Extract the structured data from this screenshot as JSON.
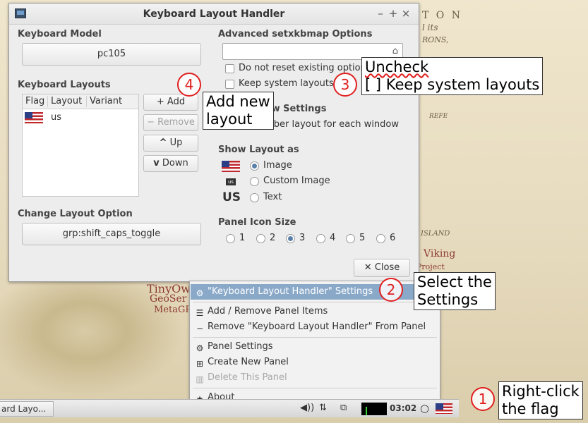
{
  "dialog": {
    "title": "Keyboard Layout Handler",
    "keyboard_model": {
      "title": "Keyboard Model",
      "value": "pc105"
    },
    "keyboard_layouts": {
      "title": "Keyboard Layouts",
      "columns": [
        "Flag",
        "Layout",
        "Variant"
      ],
      "rows": [
        {
          "flag": "us-flag-icon",
          "layout": "us",
          "variant": ""
        }
      ]
    },
    "buttons": {
      "add": "+ Add",
      "remove": "− Remove",
      "up": "Up",
      "down": "Down",
      "close": "Close"
    },
    "change_layout_option": {
      "title": "Change Layout Option",
      "value": "grp:shift_caps_toggle"
    },
    "advanced": {
      "title": "Advanced setxkbmap Options",
      "input_value": "",
      "do_not_reset": "Do not reset existing options",
      "keep_system_layouts": "Keep system layouts"
    },
    "per_window": {
      "title": "Per Window Settings",
      "remember": "Remember layout for each window"
    },
    "show_layout_as": {
      "title": "Show Layout as",
      "options": [
        "Image",
        "Custom Image",
        "Text"
      ],
      "selected": "Image",
      "text_preview": "US",
      "custom_badge": "us"
    },
    "panel_icon_size": {
      "title": "Panel Icon Size",
      "options": [
        "1",
        "2",
        "3",
        "4",
        "5",
        "6"
      ],
      "selected": "3"
    }
  },
  "context_menu": {
    "items": [
      {
        "label": "\"Keyboard Layout Handler\" Settings",
        "icon": "gear-icon",
        "highlighted": true
      },
      {
        "label": "Add / Remove Panel Items",
        "icon": "list-icon"
      },
      {
        "label": "Remove \"Keyboard Layout Handler\" From Panel",
        "icon": "minus-icon"
      },
      {
        "label": "Panel Settings",
        "icon": "gear-icon"
      },
      {
        "label": "Create New Panel",
        "icon": "plus-box-icon"
      },
      {
        "label": "Delete This Panel",
        "icon": "trash-icon",
        "disabled": true
      },
      {
        "label": "About",
        "icon": "star-icon"
      }
    ]
  },
  "panel": {
    "taskbar_item": "ard Layo...",
    "clock": "03:02"
  },
  "annotations": {
    "step1": {
      "number": "1",
      "text_line1": "Right-click",
      "text_line2": "the flag"
    },
    "step2": {
      "number": "2",
      "text_line1": "Select the",
      "text_line2": "Settings"
    },
    "step3": {
      "number": "3",
      "text_line1": "Uncheck",
      "text_line2": "[ ] Keep system layouts"
    },
    "step4": {
      "number": "4",
      "text_line1": "Add new",
      "text_line2": "layout"
    }
  },
  "background_map": {
    "labels": [
      "T O N",
      "l its",
      "RONS,",
      "REFE",
      "ISLAND",
      "Viking",
      "Project",
      "TinyOw",
      "GeoSer",
      "MetaGR"
    ]
  },
  "colors": {
    "highlight": "#8aa9c9",
    "annotation_red": "#e02020",
    "flag_red": "#c0282d",
    "flag_blue": "#2c3f86"
  }
}
